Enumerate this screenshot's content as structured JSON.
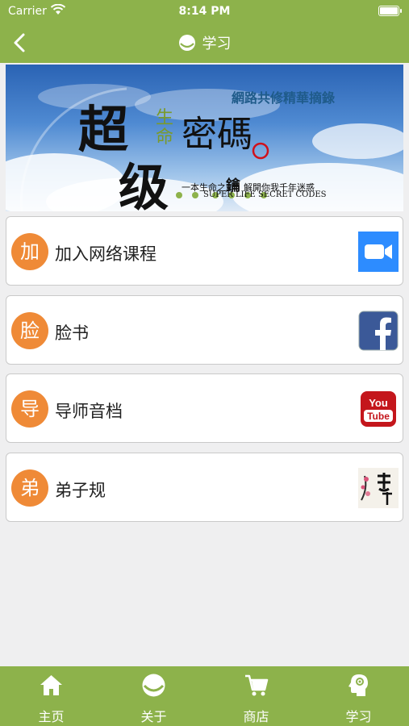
{
  "status_bar": {
    "carrier": "Carrier",
    "time": "8:14 PM"
  },
  "header": {
    "title": "学习"
  },
  "banner": {
    "title_big_1": "超",
    "title_big_2": "级",
    "title_small": "生命",
    "title_main": "密碼",
    "tagline_top": "網路共修精華摘錄",
    "tagline_bottom_1": "一本生命之",
    "tagline_key": "鑰",
    "tagline_bottom_2": "解開你我千年迷惑",
    "english": "SUPER LIFE SECRET CODES"
  },
  "menu": [
    {
      "badge": "加",
      "label": "加入网络课程",
      "icon": "zoom-icon"
    },
    {
      "badge": "脸",
      "label": "脸书",
      "icon": "facebook-icon"
    },
    {
      "badge": "导",
      "label": "导师音档",
      "icon": "youtube-icon"
    },
    {
      "badge": "弟",
      "label": "弟子规",
      "icon": "dizigui-icon"
    }
  ],
  "tabs": [
    {
      "label": "主页",
      "icon": "home-icon"
    },
    {
      "label": "关于",
      "icon": "logo-icon"
    },
    {
      "label": "商店",
      "icon": "cart-icon"
    },
    {
      "label": "学习",
      "icon": "head-icon"
    }
  ],
  "colors": {
    "brand_green": "#8db24b",
    "badge_orange": "#ef8a37",
    "background": "#efeff0"
  }
}
